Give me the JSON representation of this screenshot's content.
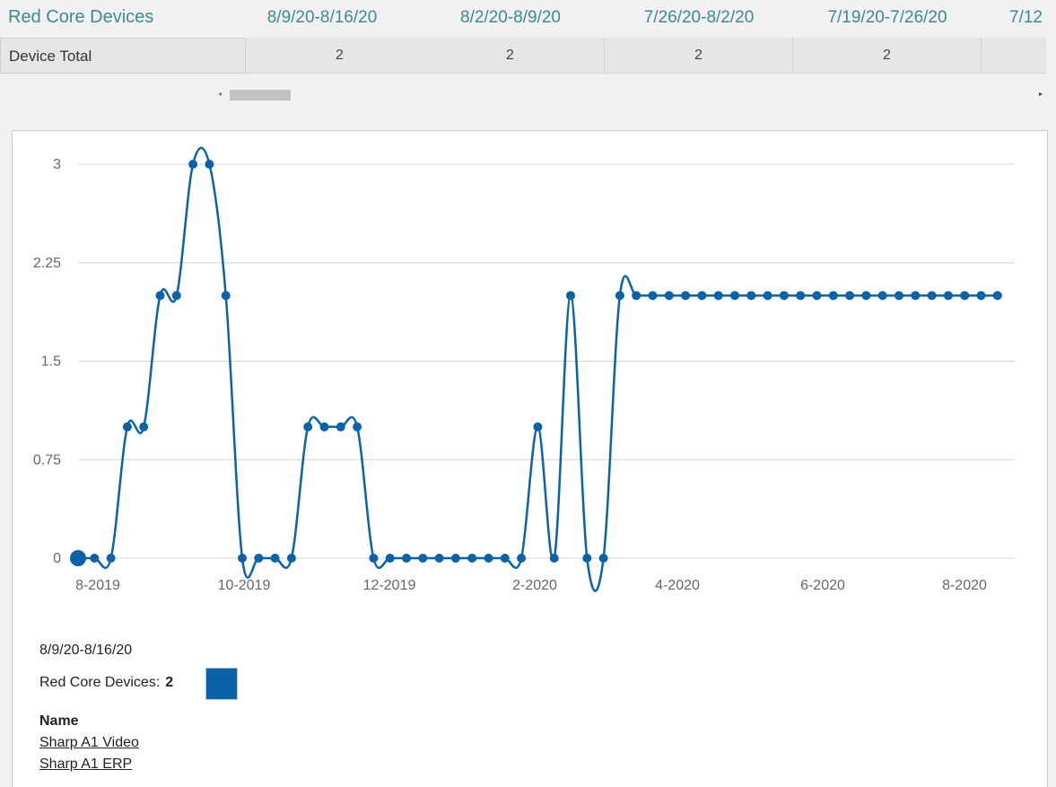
{
  "header": {
    "title": "Red Core Devices",
    "columns": [
      "8/9/20-8/16/20",
      "8/2/20-8/9/20",
      "7/26/20-8/2/20",
      "7/19/20-7/26/20",
      "7/12"
    ]
  },
  "table": {
    "row_label": "Device Total",
    "values": [
      "2",
      "2",
      "2",
      "2",
      ""
    ]
  },
  "scrollbar": {
    "left_arrow": "◂",
    "right_arrow": "▸"
  },
  "chart_data": {
    "type": "line",
    "y_ticks": [
      "3",
      "2.25",
      "1.5",
      "0.75",
      "0"
    ],
    "x_ticks": [
      "8-2019",
      "10-2019",
      "12-2019",
      "2-2020",
      "4-2020",
      "6-2020",
      "8-2020"
    ],
    "ylim": [
      0,
      3
    ],
    "grid": true,
    "series": [
      {
        "color": "#0a63a8",
        "values": [
          0,
          0,
          0,
          1,
          1,
          2,
          2,
          3,
          3,
          2,
          0,
          0,
          0,
          0,
          1,
          1,
          1,
          1,
          0,
          0,
          0,
          0,
          0,
          0,
          0,
          0,
          0,
          0,
          1,
          0,
          2,
          0,
          0,
          2,
          2,
          2,
          2,
          2,
          2,
          2,
          2,
          2,
          2,
          2,
          2,
          2,
          2,
          2,
          2,
          2,
          2,
          2,
          2,
          2,
          2,
          2,
          2
        ]
      }
    ]
  },
  "details": {
    "date": "8/9/20-8/16/20",
    "series_label": "Red Core Devices:",
    "series_value": "2",
    "swatch_color": "#0a63a8",
    "name_heading": "Name",
    "names": [
      "Sharp A1 Video",
      "Sharp A1 ERP"
    ]
  }
}
